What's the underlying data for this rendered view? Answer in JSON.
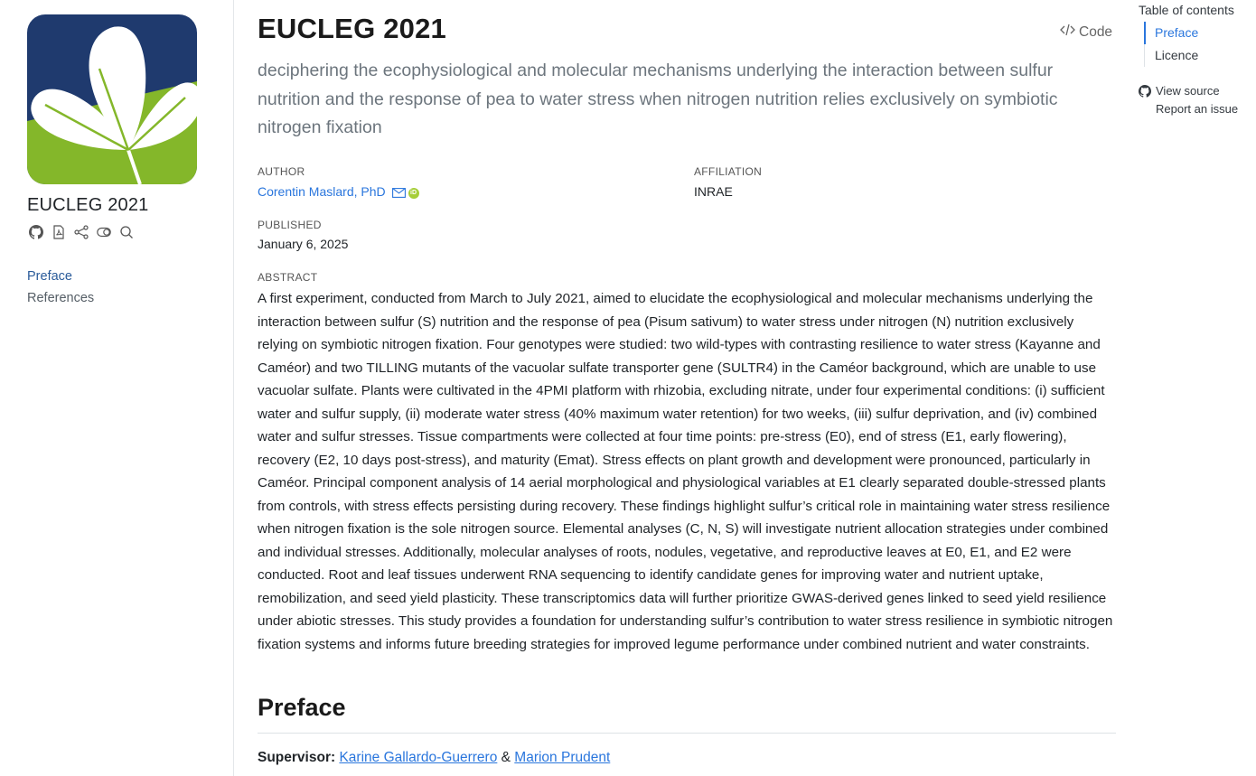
{
  "sidebar": {
    "title": "EUCLEG 2021",
    "tools": [
      "github-icon",
      "pdf-icon",
      "share-icon",
      "toggle-icon",
      "search-icon"
    ],
    "nav": [
      {
        "label": "Preface",
        "active": true
      },
      {
        "label": "References",
        "active": false
      }
    ]
  },
  "main": {
    "title": "EUCLEG 2021",
    "code_label": "Code",
    "subtitle": "deciphering the ecophysiological and molecular mechanisms underlying the interaction between sulfur nutrition and the response of pea to water stress when nitrogen nutrition relies exclusively on symbiotic nitrogen fixation",
    "meta": {
      "author_label": "AUTHOR",
      "author": "Corentin Maslard, PhD",
      "affiliation_label": "AFFILIATION",
      "affiliation": "INRAE",
      "published_label": "PUBLISHED",
      "published": "January 6, 2025",
      "abstract_label": "ABSTRACT"
    },
    "abstract": "A first experiment, conducted from March to July 2021, aimed to elucidate the ecophysiological and molecular mechanisms underlying the interaction between sulfur (S) nutrition and the response of pea (Pisum sativum) to water stress under nitrogen (N) nutrition exclusively relying on symbiotic nitrogen fixation. Four genotypes were studied: two wild-types with contrasting resilience to water stress (Kayanne and Caméor) and two TILLING mutants of the vacuolar sulfate transporter gene (SULTR4) in the Caméor background, which are unable to use vacuolar sulfate. Plants were cultivated in the 4PMI platform with rhizobia, excluding nitrate, under four experimental conditions: (i) sufficient water and sulfur supply, (ii) moderate water stress (40% maximum water retention) for two weeks, (iii) sulfur deprivation, and (iv) combined water and sulfur stresses. Tissue compartments were collected at four time points: pre-stress (E0), end of stress (E1, early flowering), recovery (E2, 10 days post-stress), and maturity (Emat). Stress effects on plant growth and development were pronounced, particularly in Caméor. Principal component analysis of 14 aerial morphological and physiological variables at E1 clearly separated double-stressed plants from controls, with stress effects persisting during recovery. These findings highlight sulfur’s critical role in maintaining water stress resilience when nitrogen fixation is the sole nitrogen source. Elemental analyses (C, N, S) will investigate nutrient allocation strategies under combined and individual stresses. Additionally, molecular analyses of roots, nodules, vegetative, and reproductive leaves at E0, E1, and E2 were conducted. Root and leaf tissues underwent RNA sequencing to identify candidate genes for improving water and nutrient uptake, remobilization, and seed yield plasticity. These transcriptomics data will further prioritize GWAS-derived genes linked to seed yield resilience under abiotic stresses. This study provides a foundation for understanding sulfur’s contribution to water stress resilience in symbiotic nitrogen fixation systems and informs future breeding strategies for improved legume performance under combined nutrient and water constraints.",
    "preface_heading": "Preface",
    "supervisor": {
      "label": "Supervisor:",
      "person1": "Karine Gallardo-Guerrero",
      "separator": " & ",
      "person2": "Marion Prudent"
    }
  },
  "toc": {
    "title": "Table of contents",
    "items": [
      {
        "label": "Preface",
        "active": true
      },
      {
        "label": "Licence",
        "active": false
      }
    ],
    "view_source": "View source",
    "report_issue": "Report an issue"
  },
  "colors": {
    "logo_blue": "#1f3a6e",
    "logo_green": "#84b72a",
    "link": "#2a76dd",
    "nav_active": "#2a5b9a",
    "orcid": "#a6ce39"
  }
}
